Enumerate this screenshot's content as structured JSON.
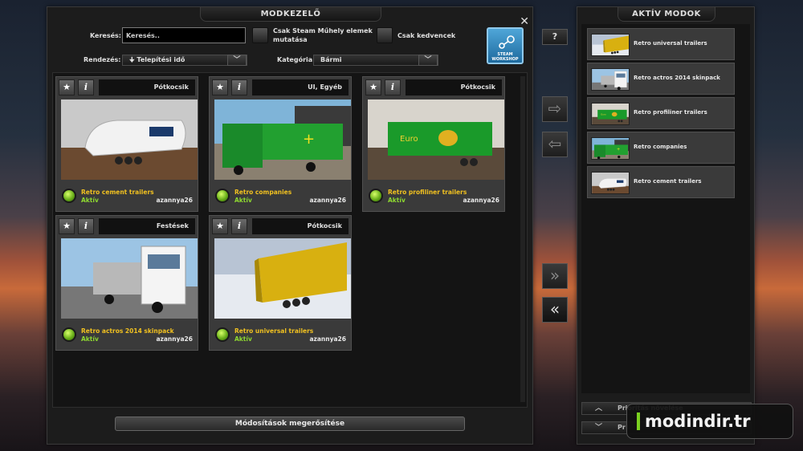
{
  "mod_manager": {
    "title": "MODKEZELŐ",
    "search_label": "Keresés:",
    "search_placeholder": "Keresés..",
    "steam_only_label_1": "Csak Steam Műhely elemek",
    "steam_only_label_2": "mutatása",
    "favorites_label": "Csak kedvencek",
    "sort_label": "Rendezés:",
    "sort_value": "Telepítési idő",
    "category_label": "Kategória:",
    "category_value": "Bármi",
    "steam_button_1": "STEAM",
    "steam_button_2": "WORKSHOP",
    "confirm_button": "Módosítások megerősítése",
    "help_button": "?"
  },
  "mods": [
    {
      "category": "Pótkocsik",
      "name": "Retro cement trailers",
      "status": "Aktív",
      "author": "azannya26",
      "thumb": "cement"
    },
    {
      "category": "UI, Egyéb",
      "name": "Retro companies",
      "status": "Aktív",
      "author": "azannya26",
      "thumb": "companies"
    },
    {
      "category": "Pótkocsik",
      "name": "Retro profiliner trailers",
      "status": "Aktív",
      "author": "azannya26",
      "thumb": "profiliner"
    },
    {
      "category": "Festések",
      "name": "Retro actros 2014 skinpack",
      "status": "Aktív",
      "author": "azannya26",
      "thumb": "actros"
    },
    {
      "category": "Pótkocsik",
      "name": "Retro universal trailers",
      "status": "Aktív",
      "author": "azannya26",
      "thumb": "universal"
    }
  ],
  "active_mods": {
    "title": "AKTÍV MODOK",
    "items": [
      {
        "name": "Retro universal trailers",
        "thumb": "universal"
      },
      {
        "name": "Retro actros 2014 skinpack",
        "thumb": "actros"
      },
      {
        "name": "Retro profiliner trailers",
        "thumb": "profiliner"
      },
      {
        "name": "Retro companies",
        "thumb": "companies"
      },
      {
        "name": "Retro cement trailers",
        "thumb": "cement"
      }
    ],
    "priority_up": "Prioritás növelése",
    "priority_down": "Pr"
  },
  "icons": {
    "favorite": "star-icon",
    "info": "info-icon",
    "move_right": "arrow-right-icon",
    "move_left": "arrow-left-icon",
    "move_all_right": "double-arrow-right-icon",
    "move_all_left": "double-arrow-left-icon",
    "close": "close-icon"
  },
  "colors": {
    "mod_name": "#f0c020",
    "status_active": "#8ed830",
    "steam_blue": "#2e86c1"
  },
  "watermark": "modindir.tr"
}
